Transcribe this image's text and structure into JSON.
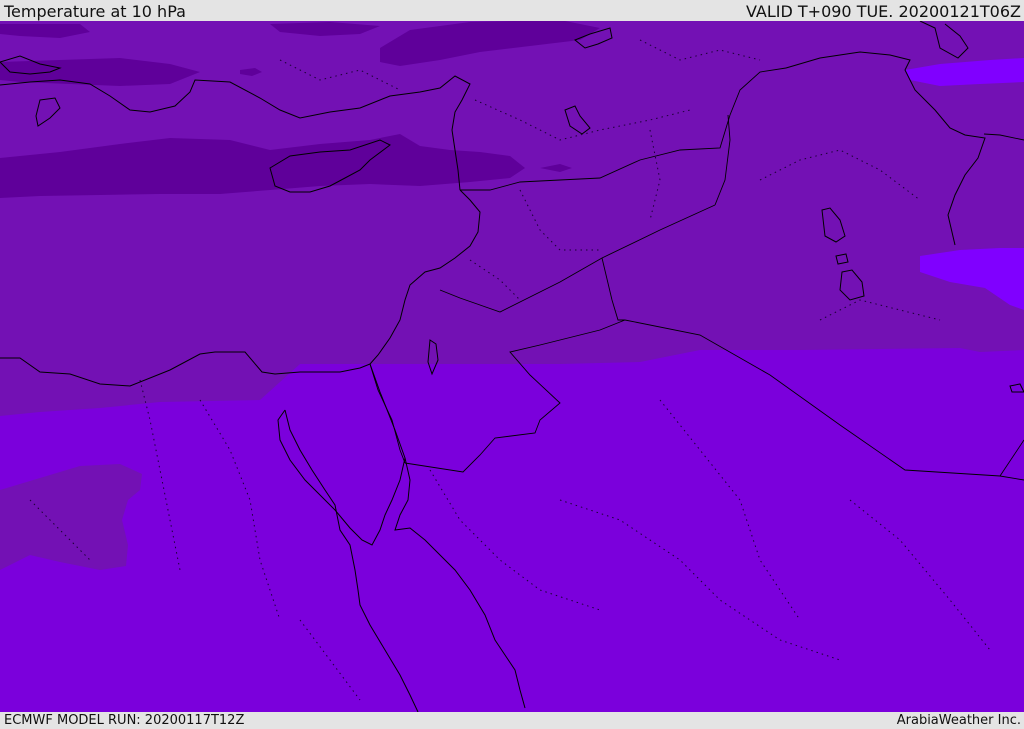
{
  "header": {
    "title": "Temperature at 10 hPa",
    "valid_time": "VALID T+090 TUE. 20200121T06Z"
  },
  "footer": {
    "model_run": "ECMWF MODEL RUN: 20200117T12Z",
    "credit": "ArabiaWeather Inc."
  },
  "colors": {
    "deep_band": "#5f009a",
    "mid_band": "#7311b4",
    "warm_band": "#7b00dc",
    "warmest_band": "#8000ff",
    "coastline": "#000000",
    "border": "#000000"
  }
}
